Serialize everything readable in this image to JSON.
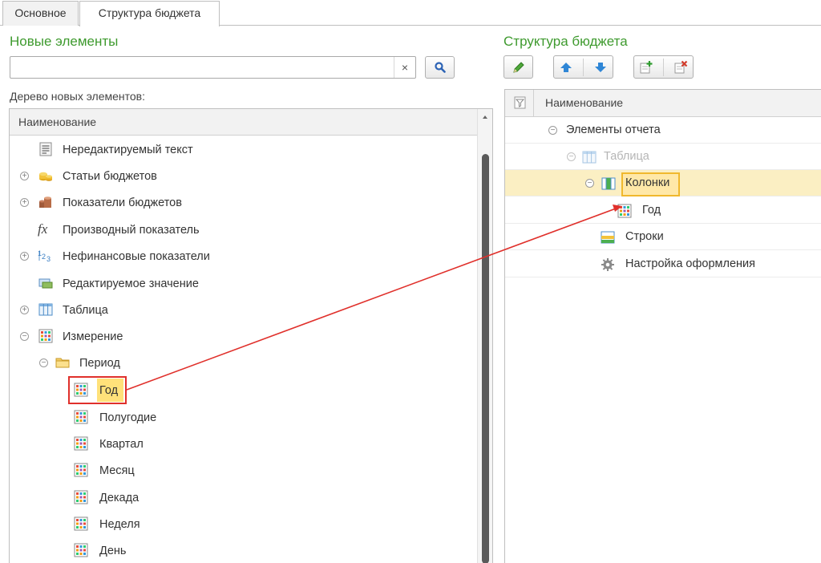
{
  "tabs": [
    {
      "label": "Основное"
    },
    {
      "label": "Структура бюджета"
    }
  ],
  "left": {
    "title": "Новые элементы",
    "search": {
      "value": "",
      "clear_glyph": "×"
    },
    "tree_caption": "Дерево новых элементов:",
    "column_header": "Наименование",
    "items": [
      {
        "label": "Нередактируемый текст",
        "icon": "text-doc-icon",
        "expander": ""
      },
      {
        "label": "Статьи бюджетов",
        "icon": "coins-icon",
        "expander": "+"
      },
      {
        "label": "Показатели бюджетов",
        "icon": "stack-icon",
        "expander": "+"
      },
      {
        "label": "Производный показатель",
        "icon": "fx-icon",
        "expander": ""
      },
      {
        "label": "Нефинансовые показатели",
        "icon": "numbers-icon",
        "expander": "+"
      },
      {
        "label": "Редактируемое значение",
        "icon": "edit-field-icon",
        "expander": ""
      },
      {
        "label": "Таблица",
        "icon": "table-icon",
        "expander": "+"
      },
      {
        "label": "Измерение",
        "icon": "dimension-grid-icon",
        "expander": "−"
      },
      {
        "label": "Период",
        "icon": "folder-icon",
        "expander": "−"
      },
      {
        "label": "Год",
        "icon": "dimension-grid-icon",
        "expander": ""
      },
      {
        "label": "Полугодие",
        "icon": "dimension-grid-icon",
        "expander": ""
      },
      {
        "label": "Квартал",
        "icon": "dimension-grid-icon",
        "expander": ""
      },
      {
        "label": "Месяц",
        "icon": "dimension-grid-icon",
        "expander": ""
      },
      {
        "label": "Декада",
        "icon": "dimension-grid-icon",
        "expander": ""
      },
      {
        "label": "Неделя",
        "icon": "dimension-grid-icon",
        "expander": ""
      },
      {
        "label": "День",
        "icon": "dimension-grid-icon",
        "expander": ""
      }
    ]
  },
  "right": {
    "title": "Структура бюджета",
    "toolbar": [
      "edit-pencil-icon",
      "arrow-up-icon",
      "arrow-down-icon",
      "add-element-icon",
      "remove-element-icon"
    ],
    "column_header": "Наименование",
    "items": [
      {
        "label": "Элементы отчета",
        "icon": "",
        "expander": "−"
      },
      {
        "label": "Таблица",
        "icon": "table-icon",
        "expander": "−",
        "dimmed": true
      },
      {
        "label": "Колонки",
        "icon": "columns-icon",
        "expander": "−",
        "selected": true
      },
      {
        "label": "Год",
        "icon": "dimension-grid-icon",
        "expander": ""
      },
      {
        "label": "Строки",
        "icon": "rows-icon",
        "expander": ""
      },
      {
        "label": "Настройка оформления",
        "icon": "gear-icon",
        "expander": ""
      }
    ]
  },
  "colors": {
    "title_green": "#3e9a2e",
    "highlight_red": "#e0302b",
    "selection_yellow": "#fbefc3",
    "label_yellow": "#ffe17a"
  }
}
